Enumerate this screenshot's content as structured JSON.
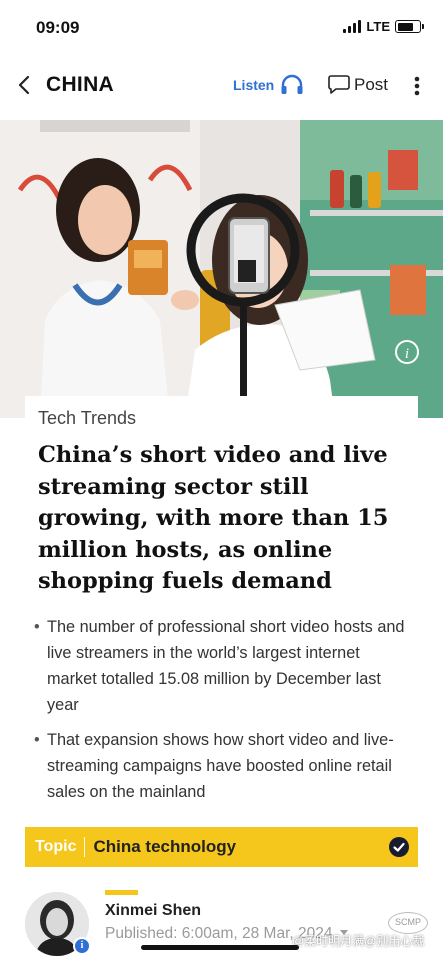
{
  "status_bar": {
    "time": "09:09",
    "network": "LTE",
    "signal_bars": 4,
    "battery_level": 0.75
  },
  "nav": {
    "title": "CHINA",
    "listen_label": "Listen",
    "post_label": "Post",
    "icons": [
      "chevron-left-icon",
      "headphones-icon",
      "speech-bubble-icon",
      "more-vertical-icon"
    ],
    "accent_color": "#2f6fd6"
  },
  "hero": {
    "info_icon": "info-icon",
    "caption_art": [
      "ring-light",
      "smartphone",
      "hosts",
      "product-shelves"
    ]
  },
  "article": {
    "section": "Tech Trends",
    "headline": "China’s short video and live streaming sector still growing, with more than 15 million hosts, as online shopping fuels demand",
    "bullets": [
      "The number of professional short video hosts and live streamers in the world’s largest internet market totalled 15.08 million by December last year",
      "That expansion shows how short video and live-streaming campaigns have boosted online retail sales on the mainland"
    ]
  },
  "topic": {
    "label": "Topic",
    "value": "China technology",
    "followed": true,
    "color": "#f5c61c"
  },
  "author": {
    "name": "Xinmei Shen",
    "published": "Published: 6:00am, 28 Mar, 2024",
    "badge": "i",
    "watermark": "@柔时明月满@别出心裁",
    "logo_text": "SCMP"
  }
}
